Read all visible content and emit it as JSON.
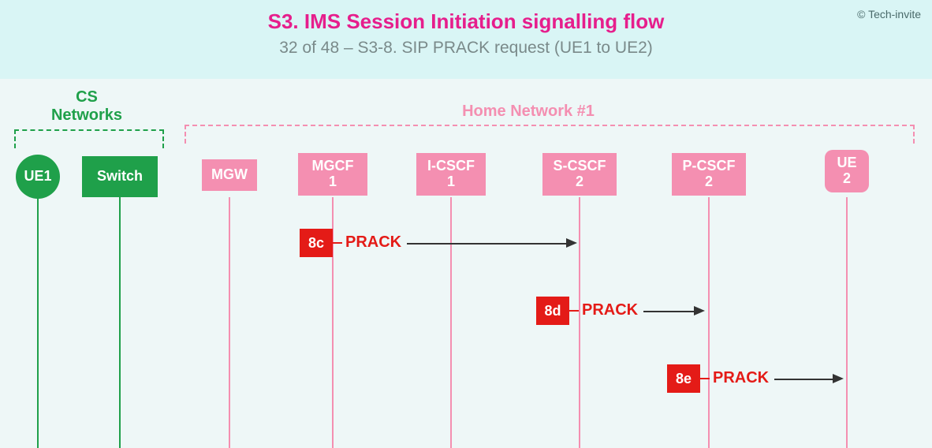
{
  "header": {
    "title": "S3. IMS Session Initiation signalling flow",
    "subtitle": "32 of 48 – S3-8. SIP PRACK request (UE1 to UE2)",
    "copyright": "© Tech-invite"
  },
  "groups": {
    "cs": {
      "label": "CS\nNetworks"
    },
    "home": {
      "label": "Home Network #1"
    }
  },
  "nodes": {
    "ue1": "UE1",
    "switch": "Switch",
    "mgw": "MGW",
    "mgcf1_l1": "MGCF",
    "mgcf1_l2": "1",
    "icscf1_l1": "I-CSCF",
    "icscf1_l2": "1",
    "scscf2_l1": "S-CSCF",
    "scscf2_l2": "2",
    "pcscf2_l1": "P-CSCF",
    "pcscf2_l2": "2",
    "ue2_l1": "UE",
    "ue2_l2": "2"
  },
  "messages": {
    "m1": {
      "step": "8c",
      "label": "PRACK"
    },
    "m2": {
      "step": "8d",
      "label": "PRACK"
    },
    "m3": {
      "step": "8e",
      "label": "PRACK"
    }
  }
}
